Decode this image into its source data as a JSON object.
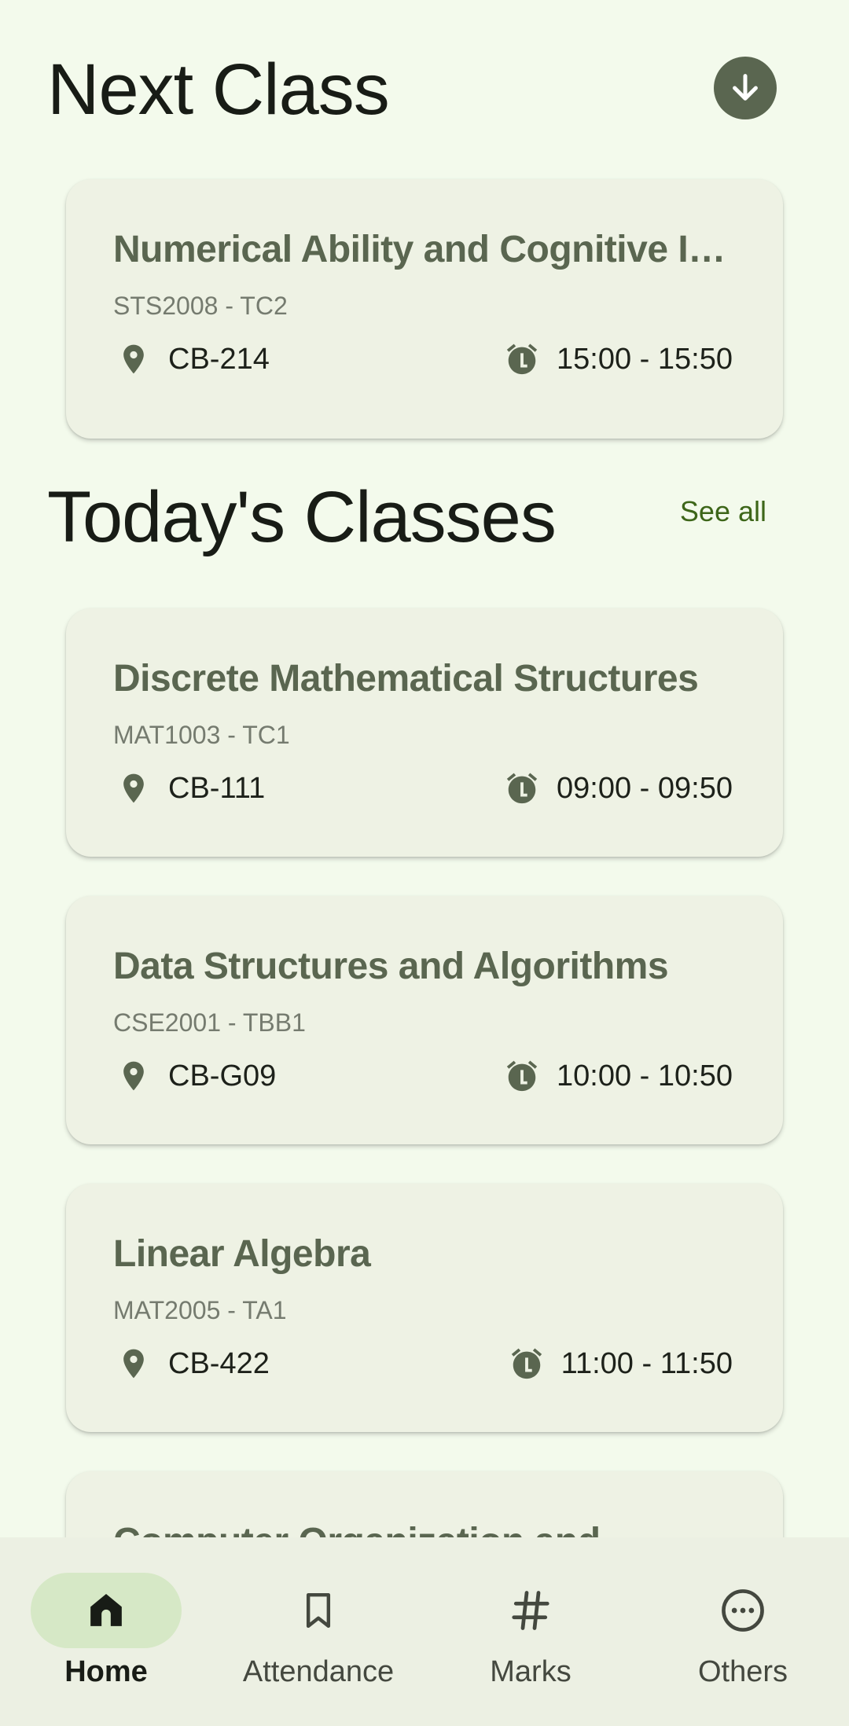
{
  "next_class": {
    "title": "Next Class",
    "download_icon": "arrow-down-circle-icon",
    "card": {
      "course": "Numerical Ability and Cognitive Int…",
      "code": "STS2008 - TC2",
      "room": "CB-214",
      "time": "15:00 - 15:50"
    }
  },
  "today": {
    "title": "Today's Classes",
    "see_all": "See all",
    "cards": [
      {
        "course": "Discrete Mathematical Structures",
        "code": "MAT1003 - TC1",
        "room": "CB-111",
        "time": "09:00 - 09:50"
      },
      {
        "course": "Data Structures and Algorithms",
        "code": "CSE2001 - TBB1",
        "room": "CB-G09",
        "time": "10:00 - 10:50"
      },
      {
        "course": "Linear Algebra",
        "code": "MAT2005 - TA1",
        "room": "CB-422",
        "time": "11:00 - 11:50"
      },
      {
        "course": "Computer Organization and",
        "code": "",
        "room": "",
        "time": ""
      }
    ]
  },
  "nav": {
    "items": [
      {
        "label": "Home",
        "icon": "home-icon",
        "active": true
      },
      {
        "label": "Attendance",
        "icon": "bookmark-icon",
        "active": false
      },
      {
        "label": "Marks",
        "icon": "hash-icon",
        "active": false
      },
      {
        "label": "Others",
        "icon": "more-horizontal-circle-icon",
        "active": false
      }
    ]
  },
  "colors": {
    "background": "#f3faec",
    "card": "#eef2e4",
    "accent": "#5a6650",
    "link": "#3d6619",
    "nav_active_pill": "#d6e8c6"
  }
}
